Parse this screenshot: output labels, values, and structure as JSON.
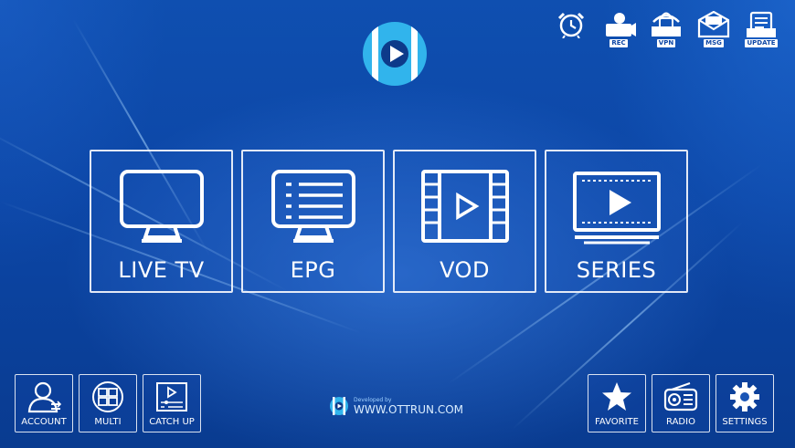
{
  "app": {
    "tagline": "Developed by",
    "website": "WWW.OTTRUN.COM"
  },
  "top_icons": [
    {
      "name": "alarm-clock-icon",
      "label": ""
    },
    {
      "name": "record-icon",
      "label": "REC"
    },
    {
      "name": "vpn-icon",
      "label": "VPN"
    },
    {
      "name": "message-icon",
      "label": "MSG"
    },
    {
      "name": "update-icon",
      "label": "UPDATE"
    }
  ],
  "tiles": [
    {
      "label": "LIVE TV",
      "icon": "tv-icon"
    },
    {
      "label": "EPG",
      "icon": "epg-list-icon"
    },
    {
      "label": "VOD",
      "icon": "film-play-icon"
    },
    {
      "label": "SERIES",
      "icon": "series-play-icon"
    }
  ],
  "bottom_left": [
    {
      "label": "ACCOUNT",
      "icon": "account-icon"
    },
    {
      "label": "MULTI",
      "icon": "multi-screen-icon"
    },
    {
      "label": "CATCH UP",
      "icon": "catch-up-icon"
    }
  ],
  "bottom_right": [
    {
      "label": "FAVORITE",
      "icon": "star-icon"
    },
    {
      "label": "RADIO",
      "icon": "radio-icon"
    },
    {
      "label": "SETTINGS",
      "icon": "gear-icon"
    }
  ],
  "colors": {
    "background": "#0c46a6",
    "accent": "#31b4ec",
    "tile_border": "#ffffff"
  }
}
